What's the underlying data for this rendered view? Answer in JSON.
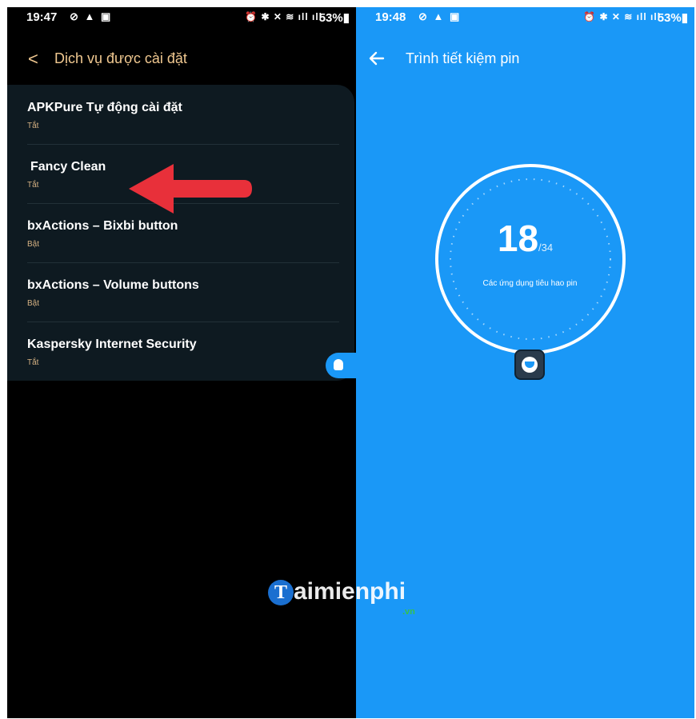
{
  "left_screen": {
    "status_bar": {
      "time": "19:47",
      "icons_left": "⊘ ▲ ▣",
      "icons_right": "⏰ ✱ ✕ ≋ ıll ıll",
      "battery": "53%▮"
    },
    "header": {
      "back_icon": "chevron-left-icon",
      "title": "Dịch vụ được cài đặt"
    },
    "services": [
      {
        "name": "APKPure Tự động cài đặt",
        "status": "Tắt"
      },
      {
        "name": "Fancy Clean",
        "status": "Tắt"
      },
      {
        "name": "bxActions – Bixbi button",
        "status": "Bật"
      },
      {
        "name": "bxActions – Volume buttons",
        "status": "Bật"
      },
      {
        "name": "Kaspersky Internet Security",
        "status": "Tắt"
      }
    ],
    "annotation_color": "#e8303a"
  },
  "right_screen": {
    "status_bar": {
      "time": "19:48",
      "icons_left": "⊘ ▲ ▣",
      "icons_right": "⏰ ✱ ✕ ≋ ıll ıll",
      "battery": "53%▮"
    },
    "header": {
      "back_icon": "arrow-left-icon",
      "title": "Trình tiết kiệm pin"
    },
    "gauge": {
      "value": "18",
      "total": "/34",
      "label": "Các ứng dụng tiêu hao pin"
    },
    "background_color": "#1a98f7"
  },
  "watermark": {
    "logo_letter": "T",
    "text": "aimienphi",
    "suffix": ".vn"
  }
}
